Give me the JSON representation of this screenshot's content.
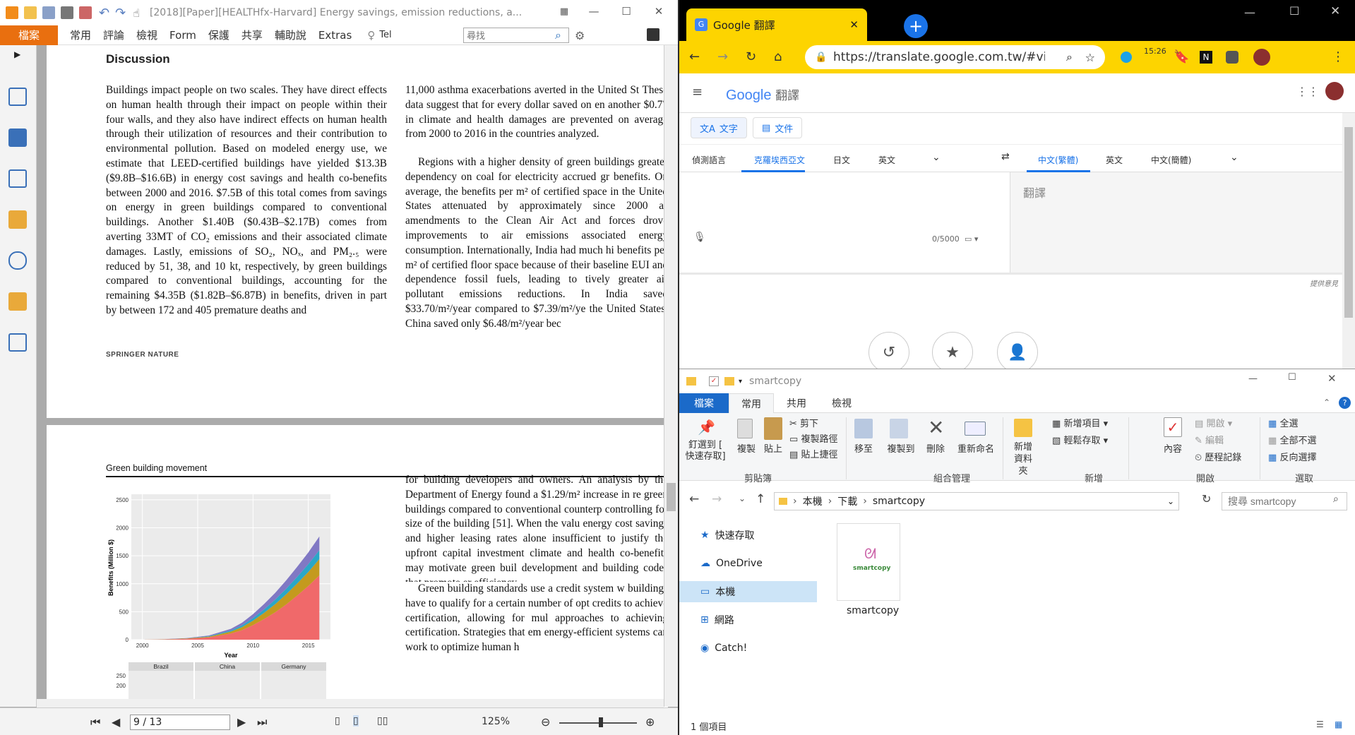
{
  "pdf": {
    "title": "[2018][Paper][HEALTHfx-Harvard] Energy savings, emission reductions, a...",
    "menu": [
      "檔案",
      "常用",
      "評論",
      "檢視",
      "Form",
      "保護",
      "共享",
      "輔助說",
      "Extras",
      "Tel"
    ],
    "search_placeholder": "尋找",
    "page1": {
      "heading": "Discussion",
      "left_col": "Buildings impact people on two scales. They have direct effects on human health through their impact on people within their four walls, and they also have indirect effects on human health through their utilization of resources and their contribution to environmental pollution. Based on modeled energy use, we estimate that LEED-certified buildings have yielded $13.3B ($9.8B–$16.6B) in energy cost savings and health co-benefits between 2000 and 2016. $7.5B of this total comes from savings on energy in green buildings compared to conventional buildings. Another $1.40B ($0.43B–$2.17B) comes from averting 33MT of CO₂ emissions and their associated climate damages. Lastly, emissions of SO₂, NOₓ, and PM₂.₅ were reduced by 51, 38, and 10 kt, respectively, by green buildings compared to conventional buildings, accounting for the remaining $4.35B ($1.82B–$6.87B) in benefits, driven in part by between 172 and 405 premature deaths and",
      "right_col": "11,000 asthma exacerbations averted in the United St These data suggest that for every dollar saved on en another $0.77 in climate and health damages are prevented on average from 2000 to 2016 in the countries analyzed.",
      "right_col_p2": "Regions with a higher density of green buildings greater dependency on coal for electricity accrued gr benefits. On average, the benefits per m² of certified space in the United States attenuated by approximately since 2000 as amendments to the Clean Air Act and forces drove improvements to air emissions associated energy consumption. Internationally, India had much hi benefits per m² of certified floor space because of their baseline EUI and dependence fossil fuels, leading to tively greater air pollutant emissions reductions. In India saved $33.70/m²/year compared to $7.39/m²/ye the United States. China saved only $6.48/m²/year bec",
      "footer": "SPRINGER NATURE"
    },
    "page2": {
      "running_head": "Green building movement",
      "right_col": "for building developers and owners. An analysis by the Department of Energy found a $1.29/m² increase in re green buildings compared to conventional counterp controlling for size of the building [51]. When the valu energy cost savings and higher leasing rates alone insufficient to justify the upfront capital investment climate and health co-benefits may motivate green buil development and building codes that promote er efficiency.",
      "right_col_p2": "Green building standards use a credit system w buildings have to qualify for a certain number of opt credits to achieve certification, allowing for mul approaches to achieving certification. Strategies that em energy-efficient systems can work to optimize human h"
    },
    "status": {
      "page": "9 / 13",
      "zoom": "125%"
    }
  },
  "chart_data": {
    "type": "area",
    "xlabel": "Year",
    "ylabel": "Benefits (Million $)",
    "x_ticks": [
      "2000",
      "2005",
      "2010",
      "2015"
    ],
    "y_ticks": [
      "0",
      "500",
      "1000",
      "1500",
      "2000",
      "2500"
    ],
    "ylim": [
      0,
      2600
    ],
    "x": [
      2000,
      2002,
      2004,
      2006,
      2008,
      2009,
      2010,
      2011,
      2012,
      2013,
      2014,
      2015,
      2016
    ],
    "series": [
      {
        "values": [
          0,
          5,
          15,
          40,
          110,
          170,
          260,
          370,
          490,
          630,
          790,
          960,
          1150
        ],
        "color": "#f0696a"
      },
      {
        "values": [
          0,
          2,
          6,
          14,
          35,
          55,
          80,
          110,
          145,
          180,
          215,
          250,
          290
        ],
        "color": "#c49a1e"
      },
      {
        "values": [
          0,
          1,
          3,
          8,
          20,
          30,
          45,
          62,
          80,
          100,
          120,
          140,
          160
        ],
        "color": "#2aa7c7"
      },
      {
        "values": [
          0,
          2,
          5,
          12,
          30,
          48,
          70,
          95,
          122,
          150,
          180,
          210,
          245
        ],
        "color": "#8078c4"
      }
    ],
    "facets": [
      "Brazil",
      "China",
      "Germany"
    ],
    "facet_y_ticks": [
      "250",
      "200"
    ]
  },
  "chrome": {
    "tab_title": "Google 翻譯",
    "url": "https://translate.google.com.tw/#view...",
    "time": "15:26",
    "logo": "Google",
    "product": "翻譯",
    "modes": [
      "文字",
      "文件"
    ],
    "src_langs": [
      "偵測語言",
      "克羅埃西亞文",
      "日文",
      "英文"
    ],
    "tgt_langs": [
      "中文(繁體)",
      "英文",
      "中文(簡體)"
    ],
    "target_placeholder": "翻譯",
    "char_count": "0/5000",
    "feedback": "提供意見"
  },
  "explorer": {
    "title": "smartcopy",
    "tabs": [
      "檔案",
      "常用",
      "共用",
      "檢視"
    ],
    "ribbon": {
      "pin": "釘選到 [\n快速存取]",
      "copy": "複製",
      "paste": "貼上",
      "cut": "剪下",
      "copy_path": "複製路徑",
      "paste_shortcut": "貼上捷徑",
      "move_to": "移至",
      "copy_to": "複製到",
      "delete": "刪除",
      "rename": "重新命名",
      "new_folder": "新增\n資料夾",
      "new_item": "新增項目",
      "easy_access": "輕鬆存取",
      "properties": "內容",
      "open": "開啟",
      "edit": "編輯",
      "history": "歷程記錄",
      "select_all": "全選",
      "select_none": "全部不選",
      "invert": "反向選擇",
      "groups": [
        "剪貼簿",
        "組合管理",
        "新增",
        "開啟",
        "選取"
      ]
    },
    "path": [
      "本機",
      "下載",
      "smartcopy"
    ],
    "search_placeholder": "搜尋 smartcopy",
    "nav": [
      "快速存取",
      "OneDrive",
      "本機",
      "網路",
      "Catch!"
    ],
    "item_name": "smartcopy",
    "item_logo": "smartcopy",
    "status": "1 個項目"
  }
}
